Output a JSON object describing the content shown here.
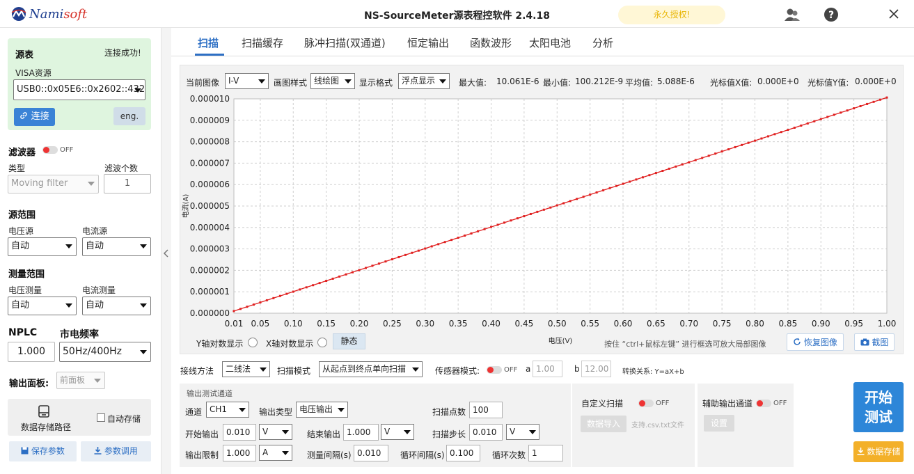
{
  "app": {
    "brand_prefix": "Nami",
    "brand_suffix": "soft",
    "title": "NS-SourceMeter源表程控软件 2.4.18",
    "license": "永久授权!"
  },
  "source": {
    "title": "源表",
    "status": "连接成功!",
    "visa_label": "VISA资源",
    "visa_value": "USB0::0x05E6::0x2602::432",
    "connect_label": "连接",
    "lang_label": "eng."
  },
  "filter": {
    "title": "滤波器",
    "state": "OFF",
    "type_label": "类型",
    "type_value": "Moving filter",
    "count_label": "滤波个数",
    "count_value": "1"
  },
  "source_range": {
    "title": "源范围",
    "voltage_label": "电压源",
    "voltage_value": "自动",
    "current_label": "电流源",
    "current_value": "自动"
  },
  "measure_range": {
    "title": "测量范围",
    "voltage_label": "电压测量",
    "voltage_value": "自动",
    "current_label": "电流测量",
    "current_value": "自动"
  },
  "nplc": {
    "label": "NPLC",
    "value": "1.000",
    "freq_label": "市电频率",
    "freq_value": "50Hz/400Hz"
  },
  "output_panel": {
    "label": "输出面板:",
    "value": "前面板"
  },
  "storage": {
    "path_label": "数据存储路径",
    "auto_label": "自动存储",
    "save_params": "保存参数",
    "load_params": "参数调用"
  },
  "tabs": [
    "扫描",
    "扫描缓存",
    "脉冲扫描(双通道)",
    "恒定输出",
    "函数波形",
    "太阳电池",
    "分析"
  ],
  "chart_toolbar": {
    "image_label": "当前图像",
    "image_value": "I-V",
    "style_label": "画图样式",
    "style_value": "线绘图",
    "format_label": "显示格式",
    "format_value": "浮点显示",
    "max_label": "最大值:",
    "max_value": "10.061E-6",
    "min_label": "最小值:",
    "min_value": "100.212E-9",
    "avg_label": "平均值:",
    "avg_value": "5.088E-6",
    "cx_label": "光标值X值:",
    "cx_value": "0.000E+0",
    "cy_label": "光标值Y值:",
    "cy_value": "0.000E+0"
  },
  "chart_data": {
    "type": "line",
    "xlabel": "电压(V)",
    "ylabel": "电流(A)",
    "xlim": [
      0.01,
      1.0
    ],
    "ylim": [
      0,
      1e-05
    ],
    "xticks": [
      "0.01",
      "0.05",
      "0.10",
      "0.15",
      "0.20",
      "0.25",
      "0.30",
      "0.35",
      "0.40",
      "0.45",
      "0.50",
      "0.55",
      "0.60",
      "0.65",
      "0.70",
      "0.75",
      "0.80",
      "0.85",
      "0.90",
      "0.95",
      "1.00"
    ],
    "yticks": [
      "0.000000",
      "0.000001",
      "0.000002",
      "0.000003",
      "0.000004",
      "0.000005",
      "0.000006",
      "0.000007",
      "0.000008",
      "0.000009",
      "0.000010"
    ],
    "series": [
      {
        "x_start": 0.01,
        "x_end": 1.0,
        "x_step": 0.01,
        "y_start": 1.00212e-07,
        "y_end": 1.0061e-05,
        "color": "#e02020"
      }
    ],
    "grid": true
  },
  "chart_footer": {
    "ylog": "Y轴对数显示",
    "xlog": "X轴对数显示",
    "static": "静态",
    "hint": "按住 “ctrl+鼠标左键” 进行框选可放大局部图像",
    "restore": "恢复图像",
    "screenshot": "截图"
  },
  "wiring": {
    "method_label": "接线方法",
    "method_value": "二线法",
    "mode_label": "扫描模式",
    "mode_value": "从起点到终点单向扫描",
    "sensor_label": "传感器模式:",
    "sensor_state": "OFF",
    "a_label": "a",
    "a_value": "1.00",
    "b_label": "b",
    "b_value": "12.00",
    "formula": "转换关系: Y=aX+b"
  },
  "channel": {
    "title": "输出测试通道",
    "channel_label": "通道",
    "channel_value": "CH1",
    "out_type_label": "输出类型",
    "out_type_value": "电压输出",
    "points_label": "扫描点数",
    "points_value": "100",
    "start_label": "开始输出",
    "start_value": "0.010",
    "start_unit": "V",
    "end_label": "结束输出",
    "end_value": "1.000",
    "end_unit": "V",
    "step_label": "扫描步长",
    "step_value": "0.010",
    "step_unit": "V",
    "limit_label": "输出限制",
    "limit_value": "1.000",
    "limit_unit": "A",
    "interval_label": "测量间隔(s)",
    "interval_value": "0.010",
    "loop_interval_label": "循环间隔(s)",
    "loop_interval_value": "0.100",
    "loop_count_label": "循环次数",
    "loop_count_value": "1"
  },
  "custom_scan": {
    "label": "自定义扫描",
    "state": "OFF",
    "import": "数据导入",
    "hint": "支持.csv.txt文件"
  },
  "aux": {
    "label": "辅助输出通道",
    "state": "OFF",
    "settings": "设置"
  },
  "actions": {
    "start": "开始测试",
    "save": "数据存储"
  }
}
